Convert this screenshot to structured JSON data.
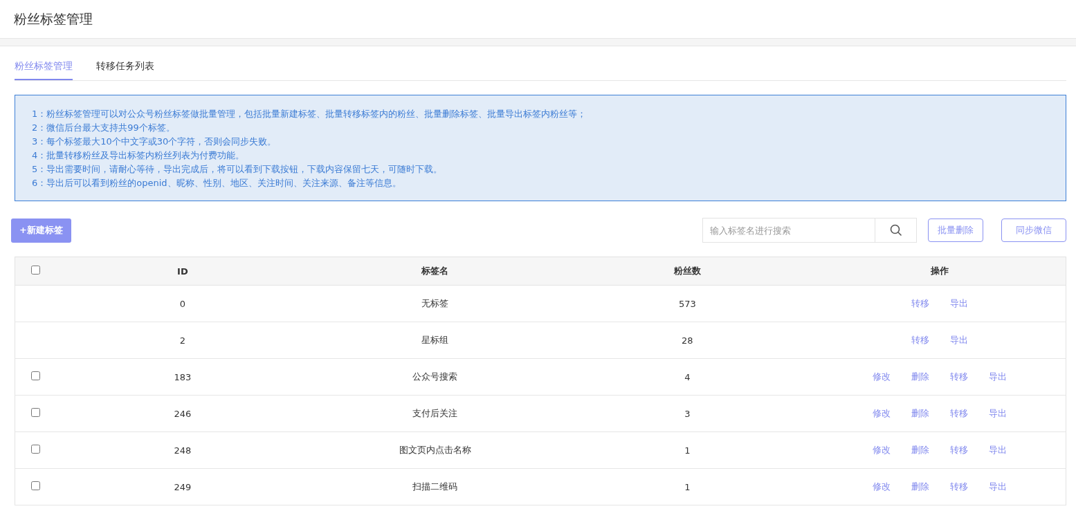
{
  "page_title": "粉丝标签管理",
  "tabs": [
    {
      "label": "粉丝标签管理",
      "selected": true
    },
    {
      "label": "转移任务列表",
      "selected": false
    }
  ],
  "notice": [
    "1：粉丝标签管理可以对公众号粉丝标签做批量管理，包括批量新建标签、批量转移标签内的粉丝、批量删除标签、批量导出标签内粉丝等；",
    "2：微信后台最大支持共99个标签。",
    "3：每个标签最大10个中文字或30个字符，否则会同步失败。",
    "4：批量转移粉丝及导出标签内粉丝列表为付费功能。",
    "5：导出需要时间，请耐心等待，导出完成后，将可以看到下载按钮，下载内容保留七天，可随时下载。",
    "6：导出后可以看到粉丝的openid、昵称、性别、地区、关注时间、关注来源、备注等信息。"
  ],
  "new_button": "+新建标签",
  "search": {
    "placeholder": "输入标签名进行搜索"
  },
  "buttons": [
    "批量删除",
    "同步微信"
  ],
  "table": {
    "select_all_checked": false,
    "columns": [
      "ID",
      "标签名",
      "粉丝数",
      "操作"
    ],
    "rows": [
      {
        "has_checkbox": false,
        "id": "0",
        "name": "无标签",
        "fans": "573",
        "actions": [
          "转移",
          "导出"
        ]
      },
      {
        "has_checkbox": false,
        "id": "2",
        "name": "星标组",
        "fans": "28",
        "actions": [
          "转移",
          "导出"
        ]
      },
      {
        "has_checkbox": true,
        "checked": false,
        "id": "183",
        "name": "公众号搜索",
        "fans": "4",
        "actions": [
          "修改",
          "删除",
          "转移",
          "导出"
        ]
      },
      {
        "has_checkbox": true,
        "checked": false,
        "id": "246",
        "name": "支付后关注",
        "fans": "3",
        "actions": [
          "修改",
          "删除",
          "转移",
          "导出"
        ]
      },
      {
        "has_checkbox": true,
        "checked": false,
        "id": "248",
        "name": "图文页内点击名称",
        "fans": "1",
        "actions": [
          "修改",
          "删除",
          "转移",
          "导出"
        ]
      },
      {
        "has_checkbox": true,
        "checked": false,
        "id": "249",
        "name": "扫描二维码",
        "fans": "1",
        "actions": [
          "修改",
          "删除",
          "转移",
          "导出"
        ]
      }
    ]
  }
}
